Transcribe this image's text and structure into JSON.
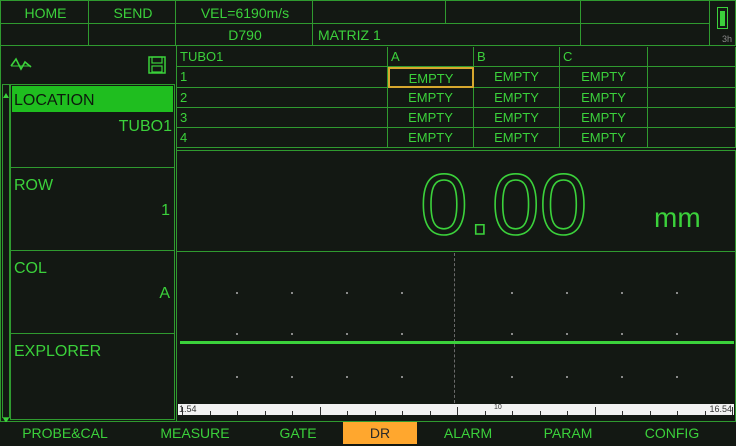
{
  "header": {
    "home": "HOME",
    "send": "SEND",
    "velocity": "VEL=6190m/s",
    "probe": "D790",
    "matrix": "MATRIZ 1",
    "battery": "3h"
  },
  "left": {
    "location_label": "LOCATION",
    "location_value": "TUBO1",
    "row_label": "ROW",
    "row_value": "1",
    "col_label": "COL",
    "col_value": "A",
    "explorer_label": "EXPLORER"
  },
  "grid": {
    "title": "TUBO1",
    "columns": [
      "A",
      "B",
      "C"
    ],
    "rows": [
      {
        "label": "1",
        "cells": [
          "EMPTY",
          "EMPTY",
          "EMPTY"
        ]
      },
      {
        "label": "2",
        "cells": [
          "EMPTY",
          "EMPTY",
          "EMPTY"
        ]
      },
      {
        "label": "3",
        "cells": [
          "EMPTY",
          "EMPTY",
          "EMPTY"
        ]
      },
      {
        "label": "4",
        "cells": [
          "EMPTY",
          "EMPTY",
          "EMPTY"
        ]
      }
    ]
  },
  "reading": {
    "value": "0.00",
    "unit": "mm"
  },
  "scale": {
    "left": "1.54",
    "mid": "10",
    "right": "16.54"
  },
  "menu": {
    "items": [
      "PROBE&CAL",
      "MEASURE",
      "GATE",
      "DR",
      "ALARM",
      "PARAM",
      "CONFIG"
    ],
    "active_index": 3
  },
  "colors": {
    "accent": "#3bd13b",
    "selected": "#1fbe1f",
    "highlight": "#ffa72e"
  }
}
